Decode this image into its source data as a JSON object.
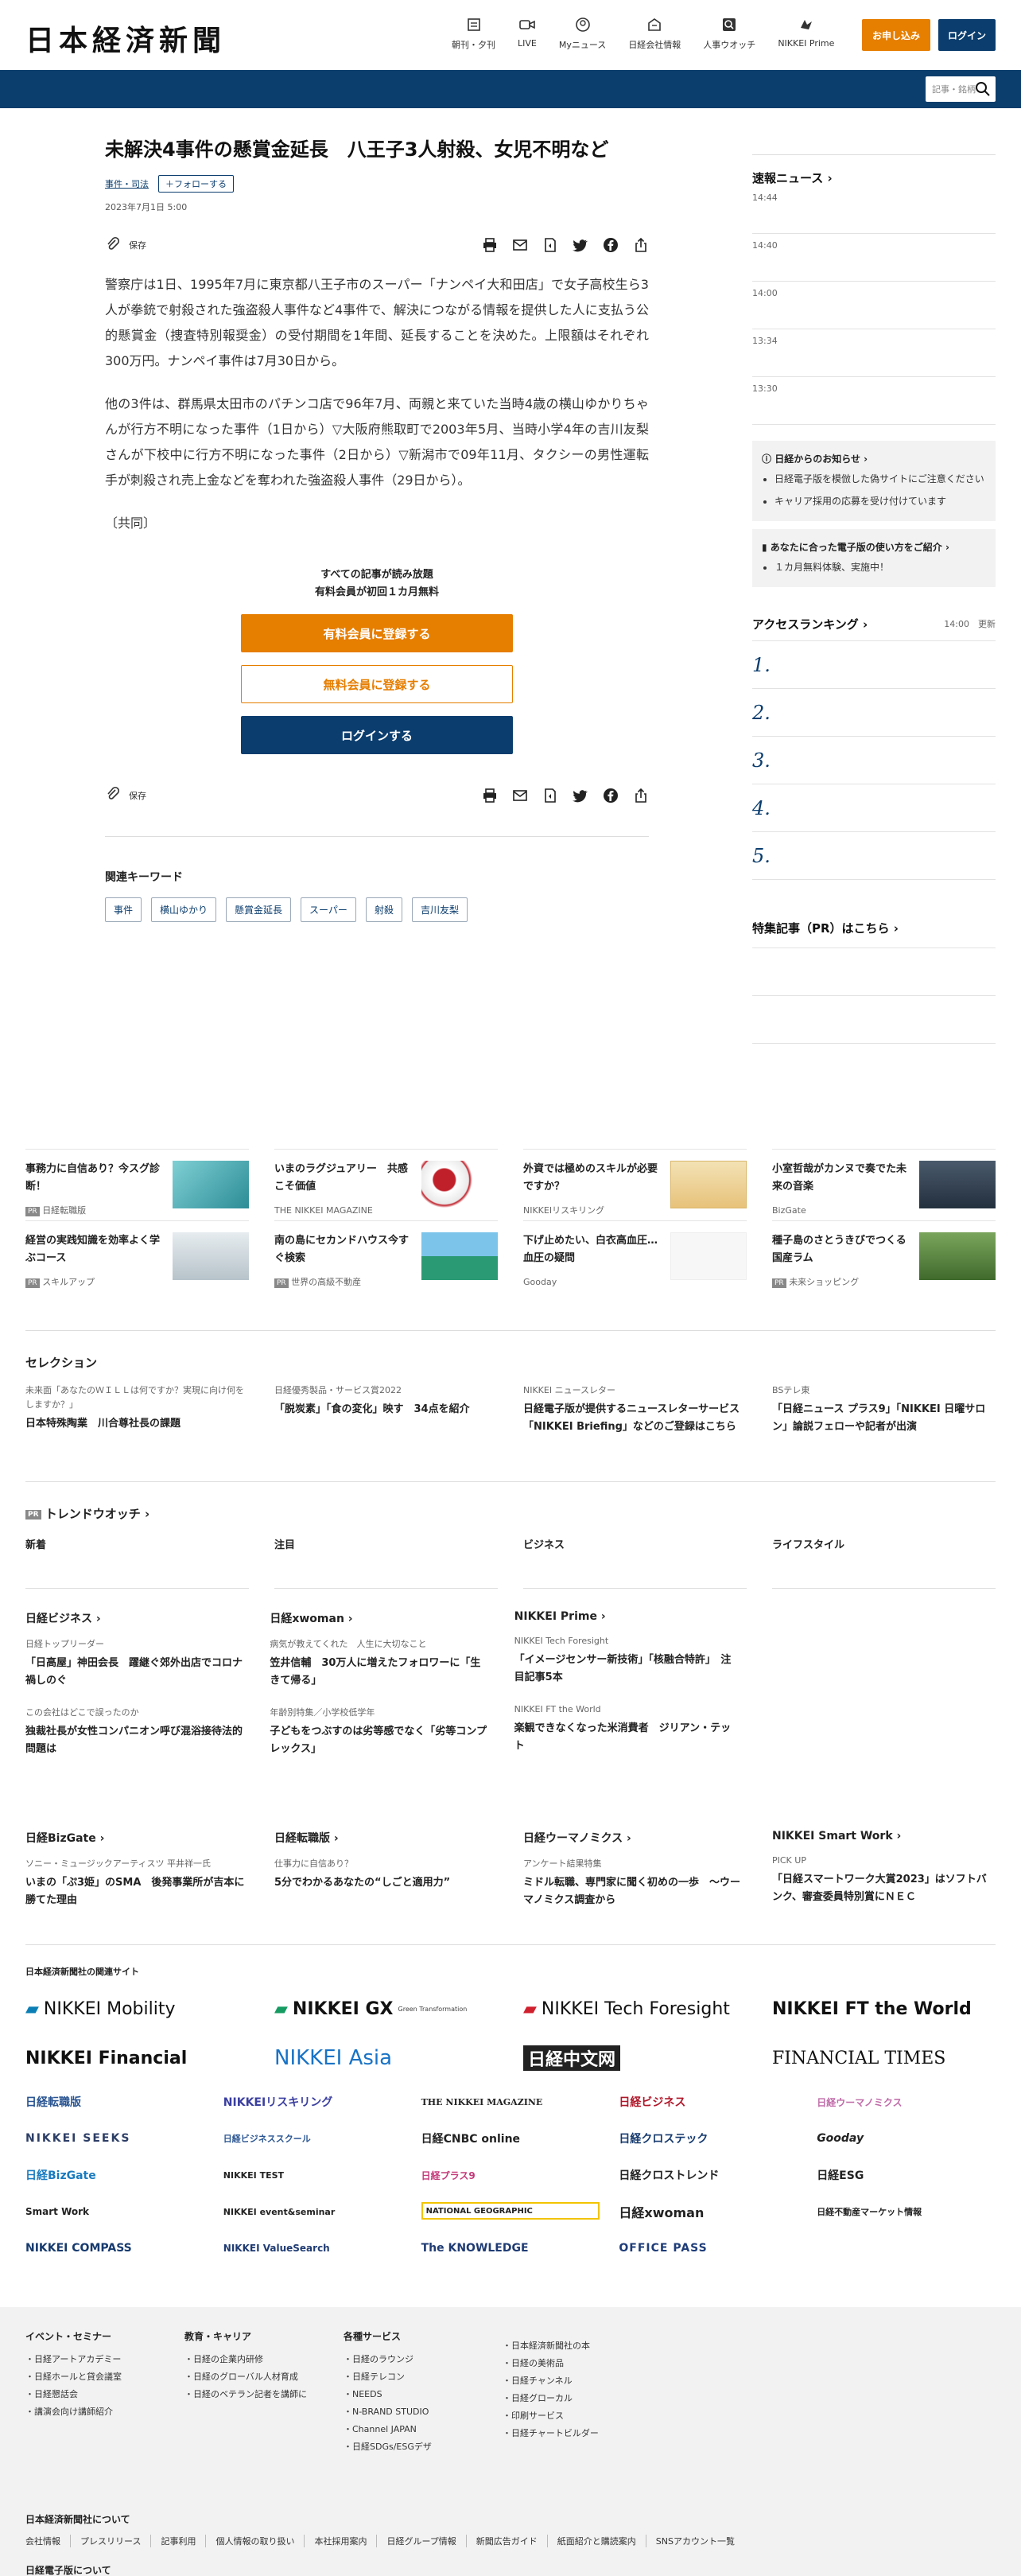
{
  "header": {
    "logo": "日本経済新聞",
    "nav": [
      {
        "icon": "newspaper-icon",
        "label": "朝刊・夕刊"
      },
      {
        "icon": "video-icon",
        "label": "LIVE"
      },
      {
        "icon": "user-icon",
        "label": "Myニュース"
      },
      {
        "icon": "building-icon",
        "label": "日経会社情報"
      },
      {
        "icon": "magnifier-icon",
        "label": "人事ウオッチ"
      },
      {
        "icon": "prime-icon",
        "label": "NIKKEI Prime"
      }
    ],
    "subscribe": "お申し込み",
    "login": "ログイン",
    "search_placeholder": "記事・銘柄"
  },
  "article": {
    "title": "未解決4事件の懸賞金延長　八王子3人射殺、女児不明など",
    "category": "事件・司法",
    "follow": "フォローする",
    "date": "2023年7月1日 5:00",
    "save": "保存",
    "paragraphs": [
      "警察庁は1日、1995年7月に東京都八王子市のスーパー「ナンペイ大和田店」で女子高校生ら3人が拳銃で射殺された強盗殺人事件など4事件で、解決につながる情報を提供した人に支払う公的懸賞金（捜査特別報奨金）の受付期間を1年間、延長することを決めた。上限額はそれぞれ300万円。ナンペイ事件は7月30日から。",
      "他の3件は、群馬県太田市のパチンコ店で96年7月、両親と来ていた当時4歳の横山ゆかりちゃんが行方不明になった事件（1日から）▽大阪府熊取町で2003年5月、当時小学4年の吉川友梨さんが下校中に行方不明になった事件（2日から）▽新潟市で09年11月、タクシーの男性運転手が刺殺され売上金などを奪われた強盗殺人事件（29日から）。",
      "〔共同〕"
    ],
    "paywall": {
      "line1": "すべての記事が読み放題",
      "line2": "有料会員が初回１カ月無料",
      "paid": "有料会員に登録する",
      "free": "無料会員に登録する",
      "login": "ログインする"
    },
    "keywords_title": "関連キーワード",
    "keywords": [
      "事件",
      "横山ゆかり",
      "懸賞金延長",
      "スーパー",
      "射殺",
      "吉川友梨"
    ]
  },
  "sidebar": {
    "breaking_title": "速報ニュース",
    "times": [
      "14:44",
      "14:40",
      "14:00",
      "13:34",
      "13:30"
    ],
    "notice_title": "日経からのお知らせ",
    "notices": [
      "日経電子版を模倣した偽サイトにご注意ください",
      "キャリア採用の応募を受け付けています"
    ],
    "ebook_title": "あなたに合った電子版の使い方をご紹介",
    "ebook_items": [
      "１カ月無料体験、実施中！"
    ],
    "ranking_title": "アクセスランキング",
    "ranking_time": "14:00",
    "ranking_update": "更新",
    "ranks": [
      "1.",
      "2.",
      "3.",
      "4.",
      "5."
    ],
    "feature_title": "特集記事（PR）はこちら"
  },
  "ads": [
    {
      "title": "事務力に自信あり？今スグ診断！",
      "sponsor": "日経転職版",
      "pr": "PR"
    },
    {
      "title": "いまのラグジュアリー　共感こそ価値",
      "sponsor": "THE NIKKEI MAGAZINE",
      "pr": ""
    },
    {
      "title": "外資では極めのスキルが必要ですか？",
      "sponsor": "NIKKEIリスキリング",
      "pr": ""
    },
    {
      "title": "小室哲哉がカンヌで奏でた未来の音楽",
      "sponsor": "BizGate",
      "pr": ""
    },
    {
      "title": "経営の実践知識を効率よく学ぶコース",
      "sponsor": "スキルアップ",
      "pr": "PR"
    },
    {
      "title": "南の島にセカンドハウス今すぐ検索",
      "sponsor": "世界の高級不動産",
      "pr": "PR"
    },
    {
      "title": "下げ止めたい、白衣高血圧…血圧の疑問",
      "sponsor": "Gooday",
      "pr": ""
    },
    {
      "title": "種子島のさとうきびでつくる国産ラム",
      "sponsor": "未来ショッピング",
      "pr": "PR"
    }
  ],
  "selection": {
    "title": "セレクション",
    "items": [
      {
        "kicker": "未来面「あなたのＷＩＬＬは何ですか？実現に向け何をしますか？」",
        "title": "日本特殊陶業　川合尊社長の課題"
      },
      {
        "kicker": "日経優秀製品・サービス賞2022",
        "title": "「脱炭素」「食の変化」映す　34点を紹介"
      },
      {
        "kicker": "NIKKEI ニュースレター",
        "title": "日経電子版が提供するニュースレターサービス「NIKKEI Briefing」などのご登録はこちら"
      },
      {
        "kicker": "BSテレ東",
        "title": "「日経ニュース プラス9」「NIKKEI 日曜サロン」論説フェローや記者が出演"
      }
    ]
  },
  "trend": {
    "pr": "PR",
    "title": "トレンドウオッチ",
    "tabs": [
      "新着",
      "注目",
      "ビジネス",
      "ライフスタイル"
    ]
  },
  "columns": [
    {
      "title": "日経ビジネス",
      "items": [
        {
          "kicker": "日経トップリーダー",
          "title": "「日高屋」神田会長　躍継ぐ郊外出店でコロナ禍しのぐ"
        },
        {
          "kicker": "この会社はどこで誤ったのか",
          "title": "独裁社長が女性コンパニオン呼び混浴接待法的問題は"
        }
      ]
    },
    {
      "title": "日経xwoman",
      "items": [
        {
          "kicker": "病気が教えてくれた　人生に大切なこと",
          "title": "笠井信輔　30万人に増えたフォロワーに「生きて帰る」"
        },
        {
          "kicker": "年齢別特集／小学校低学年",
          "title": "子どもをつぶすのは劣等感でなく「劣等コンプレックス」"
        }
      ]
    },
    {
      "title": "NIKKEI Prime",
      "items": [
        {
          "kicker": "NIKKEI Tech Foresight",
          "title": "「イメージセンサー新技術」「核融合特許」　注目記事5本"
        },
        {
          "kicker": "NIKKEI FT the World",
          "title": "楽観できなくなった米消費者　ジリアン・テット"
        }
      ]
    }
  ],
  "columns2": [
    {
      "title": "日経BizGate",
      "kicker": "ソニー・ミュージックアーティスツ 平井祥一氏",
      "text": "いまの「ぷ3姫」のSMA　後発事業所が吉本に勝てた理由"
    },
    {
      "title": "日経転職版",
      "kicker": "仕事力に自信あり？",
      "text": "5分でわかるあなたの“しごと適用力”"
    },
    {
      "title": "日経ウーマノミクス",
      "kicker": "アンケート結果特集",
      "text": "ミドル転職、専門家に聞く初めの一歩　～ウーマノミクス調査から"
    },
    {
      "title": "NIKKEI Smart Work",
      "kicker": "PICK UP",
      "text": "「日経スマートワーク大賞2023」はソフトバンク、審査委員特別賞にＮＥＣ"
    }
  ],
  "related": {
    "title": "日本経済新聞社の関連サイト",
    "brands": [
      "NIKKEI Mobility",
      "NIKKEI GX",
      "NIKKEI Tech Foresight",
      "NIKKEI FT the World",
      "NIKKEI Financial",
      "NIKKEI Asia",
      "日経中文网",
      "FINANCIAL TIMES"
    ],
    "gx_sub": "Green Transformation",
    "logos": [
      "日経転職版",
      "NIKKEIリスキリング",
      "THE NIKKEI MAGAZINE",
      "日経ビジネス",
      "日経ウーマノミクス",
      "NIKKEI SEEKS",
      "日経ビジネススクール",
      "日経CNBC online",
      "日経クロステック",
      "Gooday",
      "日経BizGate",
      "NIKKEI TEST",
      "日経プラス9",
      "日経クロストレンド",
      "日経ESG",
      "Smart Work",
      "NIKKEI event&seminar",
      "NATIONAL GEOGRAPHIC",
      "日経xwoman",
      "日経不動産マーケット情報",
      "NIKKEI COMPASS",
      "NIKKEI ValueSearch",
      "The KNOWLEDGE",
      "OFFICE PASS"
    ]
  },
  "footer": {
    "cols": [
      {
        "title": "イベント・セミナー",
        "items": [
          "日経アートアカデミー",
          "日経ホールと貸会議室",
          "日経懇話会",
          "講演会向け講師紹介"
        ]
      },
      {
        "title": "教育・キャリア",
        "items": [
          "日経の企業内研修",
          "日経のグローバル人材育成",
          "日経のベテラン記者を講師に"
        ]
      },
      {
        "title": "各種サービス",
        "items": [
          "日経のラウンジ",
          "日経テレコン",
          "NEEDS",
          "N-BRAND STUDIO",
          "Channel JAPAN",
          "日経SDGs/ESGデザ"
        ]
      },
      {
        "title": "",
        "items": [
          "日本経済新聞社の本",
          "日経の美術品",
          "日経チャンネル",
          "日経グローカル",
          "印刷サービス",
          "日経チャートビルダー"
        ]
      }
    ],
    "about": "日本経済新聞社について",
    "links": [
      "会社情報",
      "プレスリリース",
      "記事利用",
      "個人情報の取り扱い",
      "本社採用案内",
      "日経グループ情報",
      "新聞広告ガイド",
      "紙面紹介と購読案内",
      "SNSアカウント一覧"
    ],
    "bottom": "日経電子版について"
  },
  "colors": {
    "navy": "#0c3e6d",
    "orange": "#e67e00"
  }
}
